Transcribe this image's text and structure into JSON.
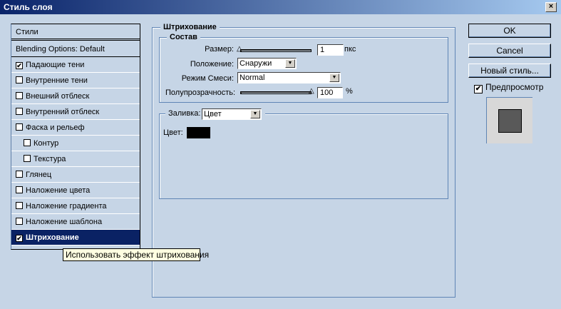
{
  "window": {
    "title": "Стиль слоя",
    "close_label": "×"
  },
  "styles_list": {
    "header": "Стили",
    "blending": "Blending Options: Default",
    "items": [
      {
        "label": "Падающие тени",
        "checked": true
      },
      {
        "label": "Внутренние тени",
        "checked": false
      },
      {
        "label": "Внешний отблеск",
        "checked": false
      },
      {
        "label": "Внутренний отблеск",
        "checked": false
      },
      {
        "label": "Фаска и рельеф",
        "checked": false
      },
      {
        "label": "Контур",
        "checked": false
      },
      {
        "label": "Текстура",
        "checked": false
      },
      {
        "label": "Глянец",
        "checked": false
      },
      {
        "label": "Наложение цвета",
        "checked": false
      },
      {
        "label": "Наложение градиента",
        "checked": false
      },
      {
        "label": "Наложение шаблона",
        "checked": false
      },
      {
        "label": "Штрихование",
        "checked": true
      }
    ]
  },
  "stroke": {
    "title": "Штрихование",
    "structure": {
      "title": "Состав",
      "size_label": "Размер:",
      "size_value": "1",
      "size_unit": "пкс",
      "position_label": "Положение:",
      "position_value": "Снаружи",
      "blend_label": "Режим Смеси:",
      "blend_value": "Normal",
      "opacity_label": "Полупрозрачность:",
      "opacity_value": "100",
      "opacity_unit": "%"
    },
    "fill": {
      "label": "Заливка:",
      "type_value": "Цвет",
      "color_label": "Цвет:",
      "color": "#000000"
    }
  },
  "buttons": {
    "ok": "OK",
    "cancel": "Cancel",
    "new_style": "Новый стиль...",
    "preview_label": "Предпросмотр",
    "preview_checked": true
  },
  "tooltip": "Использовать эффект штрихования"
}
